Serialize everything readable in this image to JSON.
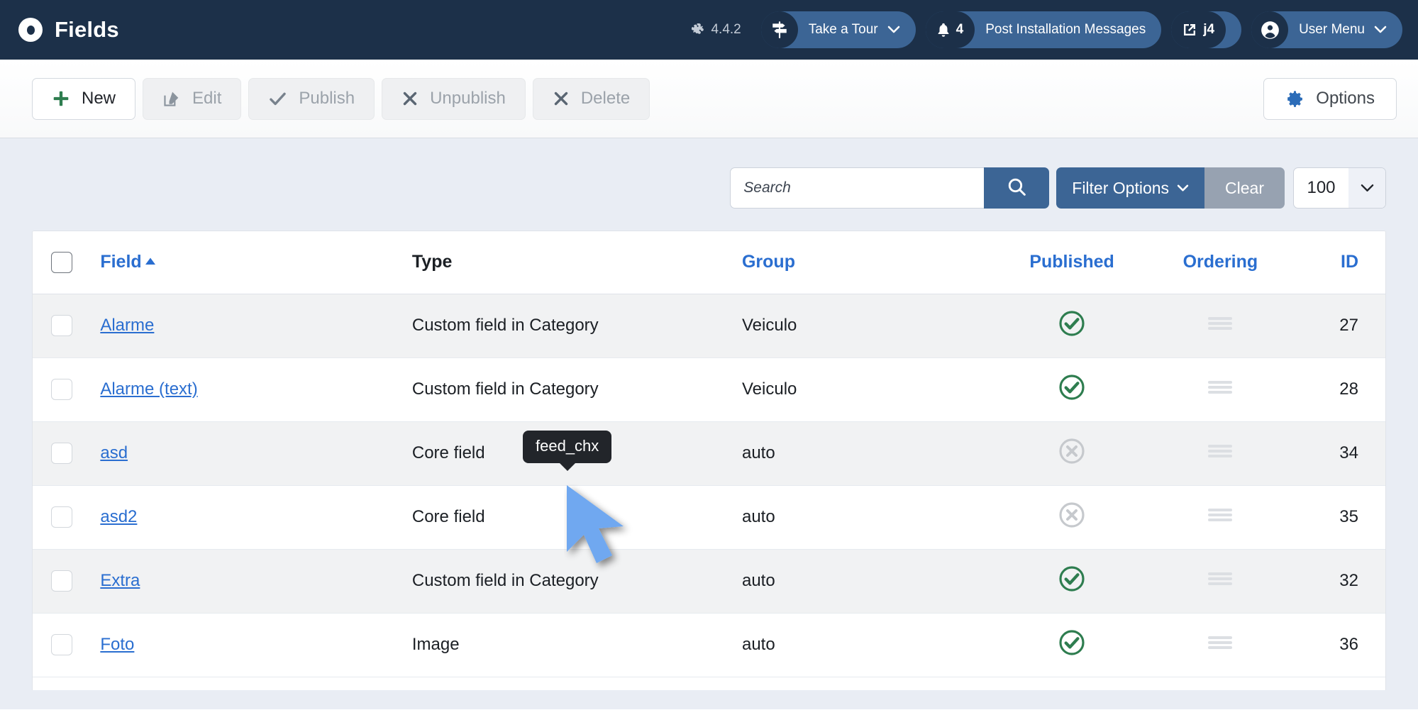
{
  "header": {
    "title": "Fields",
    "logo_icon": "joomla-circle-icon",
    "version_icon": "joomla-logo-icon",
    "version": "4.4.2",
    "take_a_tour": {
      "label": "Take a Tour",
      "icon": "signpost-icon",
      "caret_icon": "chevron-down-icon"
    },
    "messages": {
      "label": "Post Installation Messages",
      "icon": "bell-icon",
      "count": "4"
    },
    "site_link": {
      "label": "j4",
      "icon": "external-link-icon"
    },
    "user_menu": {
      "label": "User Menu",
      "icon": "user-circle-icon",
      "caret_icon": "chevron-down-icon"
    }
  },
  "toolbar": {
    "new_label": "New",
    "new_icon": "plus-icon",
    "edit_label": "Edit",
    "edit_icon": "pencil-square-icon",
    "publish_label": "Publish",
    "publish_icon": "check-icon",
    "unpublish_label": "Unpublish",
    "unpublish_icon": "times-icon",
    "delete_label": "Delete",
    "delete_icon": "times-icon",
    "options_label": "Options",
    "options_icon": "gear-icon"
  },
  "filters": {
    "search_placeholder": "Search",
    "search_value": "",
    "search_icon": "search-icon",
    "filter_options_label": "Filter Options",
    "filter_caret_icon": "chevron-down-icon",
    "clear_label": "Clear",
    "limit_value": "100",
    "limit_caret_icon": "chevron-down-icon"
  },
  "table": {
    "columns": {
      "field": "Field",
      "type": "Type",
      "group": "Group",
      "published": "Published",
      "ordering": "Ordering",
      "id": "ID"
    },
    "sort_direction_icon": "caret-up-icon",
    "rows": [
      {
        "field": "Alarme",
        "type": "Custom field in Category",
        "group": "Veiculo",
        "published": "published",
        "id": "27"
      },
      {
        "field": "Alarme (text)",
        "type": "Custom field in Category",
        "group": "Veiculo",
        "published": "published",
        "id": "28"
      },
      {
        "field": "asd",
        "type": "Core field",
        "group": "auto",
        "published": "unpublished",
        "id": "34"
      },
      {
        "field": "asd2",
        "type": "Core field",
        "group": "auto",
        "published": "unpublished",
        "id": "35"
      },
      {
        "field": "Extra",
        "type": "Custom field in Category",
        "group": "auto",
        "published": "published",
        "id": "32"
      },
      {
        "field": "Foto",
        "type": "Image",
        "group": "auto",
        "published": "published",
        "id": "36"
      }
    ]
  },
  "tooltip": {
    "text": "feed_chx"
  },
  "cursor": {
    "icon": "arrow-pointer"
  },
  "colors": {
    "header_bg": "#1c3049",
    "pill_bg": "#3c6595",
    "accent_blue": "#2a6ed0",
    "primary_button": "#3c6595",
    "clear_button": "#97a2b1",
    "published_green": "#2e7d4f",
    "unpublished_gray": "#c6c9cd",
    "page_bg": "#e9edf4",
    "cursor_blue": "#6fa8f0"
  }
}
